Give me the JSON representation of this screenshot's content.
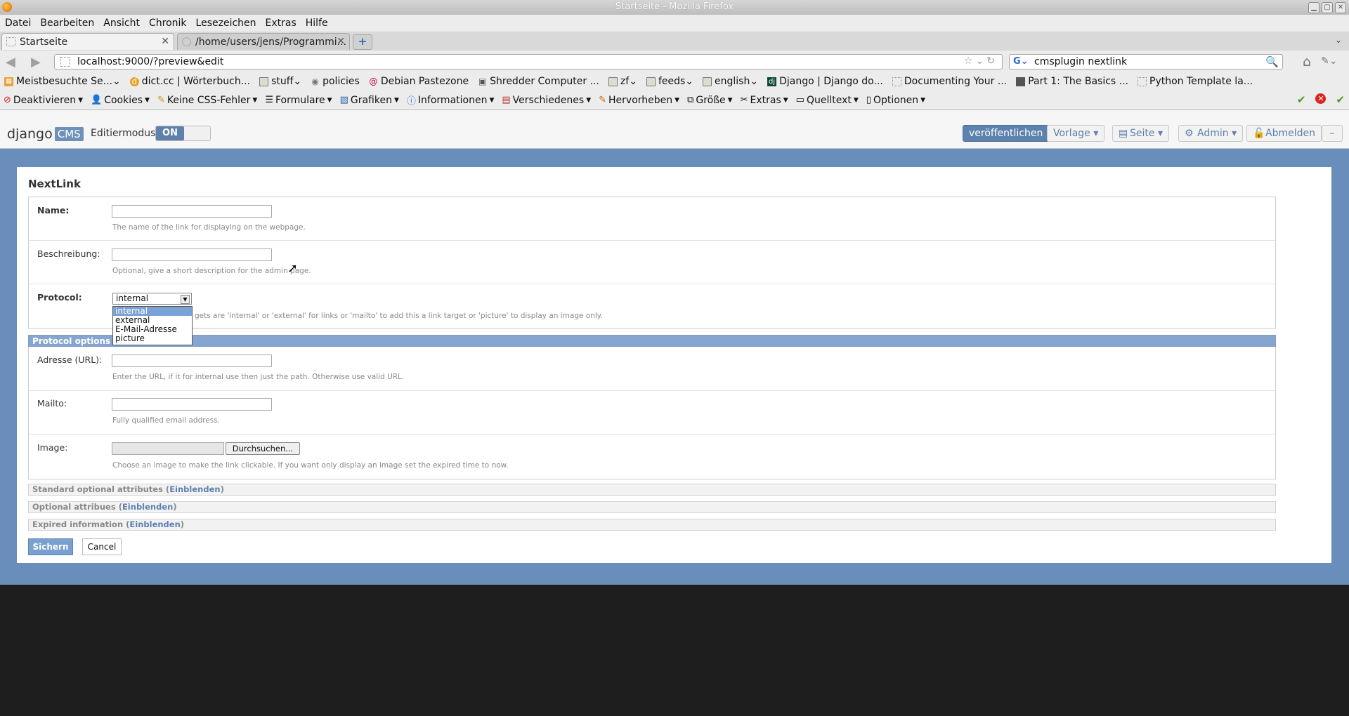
{
  "window": {
    "title": "Startseite - Mozilla Firefox"
  },
  "menu": [
    "Datei",
    "Bearbeiten",
    "Ansicht",
    "Chronik",
    "Lesezeichen",
    "Extras",
    "Hilfe"
  ],
  "tabs": [
    {
      "label": "Startseite",
      "active": true
    },
    {
      "label": "/home/users/jens/Programmi...",
      "active": false
    }
  ],
  "nav": {
    "url": "localhost:9000/?preview&edit",
    "search": "cmsplugin nextlink"
  },
  "bookmarks": [
    "Meistbesuchte Se...",
    "dict.cc | Wörterbuch...",
    "stuff",
    "policies",
    "Debian Pastezone",
    "Shredder Computer ...",
    "zf",
    "feeds",
    "english",
    "Django | Django do...",
    "Documenting Your ...",
    "Part 1: The Basics ...",
    "Python Template la..."
  ],
  "webdev": [
    "Deaktivieren",
    "Cookies",
    "Keine CSS-Fehler",
    "Formulare",
    "Grafiken",
    "Informationen",
    "Verschiedenes",
    "Hervorheben",
    "Größe",
    "Extras",
    "Quelltext",
    "Optionen"
  ],
  "cms": {
    "logo_text": "django",
    "logo_badge": "CMS",
    "edit_label": "Editiermodus",
    "toggle": "ON",
    "publish": "veröffentlichen",
    "template": "Vorlage ▾",
    "page": "Seite ▾",
    "admin": "Admin ▾",
    "logout": "Abmelden",
    "minimize": "–"
  },
  "form": {
    "title": "NextLink",
    "name_label": "Name:",
    "name_help": "The name of the link for displaying on the webpage.",
    "desc_label": "Beschreibung:",
    "desc_help": "Optional, give a short description for the admin page.",
    "protocol_label": "Protocol:",
    "protocol_value": "internal",
    "protocol_help": "gets are 'internal' or 'external' for links or 'mailto' to add this a link target or 'picture' to display an image only.",
    "protocol_options": [
      "internal",
      "external",
      "E-Mail-Adresse",
      "picture"
    ],
    "protocol_options_head": "Protocol options",
    "url_label": "Adresse (URL):",
    "url_help": "Enter the URL, if it for internal use then just the path. Otherwise use valid URL.",
    "mailto_label": "Mailto:",
    "mailto_help": "Fully qualified email address.",
    "image_label": "Image:",
    "browse": "Durchsuchen...",
    "image_help": "Choose an image to make the link clickable. If you want only display an image set the expired time to now.",
    "sections": [
      {
        "title": "Standard optional attributes",
        "link": "Einblenden"
      },
      {
        "title": "Optional attribues",
        "link": "Einblenden"
      },
      {
        "title": "Expired information",
        "link": "Einblenden"
      }
    ],
    "save": "Sichern",
    "cancel": "Cancel"
  }
}
